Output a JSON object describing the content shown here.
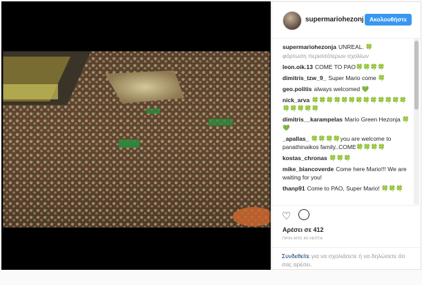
{
  "header": {
    "username": "supermariohezonj",
    "follow_label": "Ακολουθήστε"
  },
  "comments": [
    {
      "user": "supermariohezonja",
      "text": "UNREAL.",
      "clover": "🍀"
    },
    {
      "user": "leon.oik.13",
      "text": "COME TO PAO🍀🍀🍀🍀"
    },
    {
      "user": "dimitris_tzw_9_",
      "text": "Super Mario come 🍀"
    },
    {
      "user": "geo.politis",
      "text": "always welcomed",
      "clover": "💚"
    },
    {
      "user": "nick_arva",
      "text": "🍀🍀🍀🍀🍀🍀🍀🍀🍀🍀🍀🍀🍀🍀🍀🍀🍀🍀"
    },
    {
      "user": "dimitris__karampelas",
      "text": "Mario Green Hezonja 🍀💚"
    },
    {
      "user": "_apallas_",
      "text": "🍀🍀🍀🍀you are welcome to panathinaikos family..COME🍀🍀🍀🍀"
    },
    {
      "user": "kostas_chronas",
      "text": "🍀🍀🍀"
    },
    {
      "user": "mike_biancoverde",
      "text": "Come here Mario!!! We are waiting for you!"
    },
    {
      "user": "thanp91",
      "text": "Come to PAO, Super Mario! 🍀🍀🍀"
    }
  ],
  "load_more": "φόρτωση περισσότερων σχολίων",
  "actions": {
    "likes": "Αρέσει σε 412",
    "time": "ΠΡΙΝ ΑΠΟ 40 ΛΕΠΤΑ"
  },
  "login": {
    "link": "Συνδεθείτε",
    "text": "για να σχολιάσετε ή να δηλώσετε ότι σας αρέσει."
  },
  "colors": {
    "follow_button": "#3897f0",
    "link": "#003569",
    "clover": "#2e9b3a"
  }
}
